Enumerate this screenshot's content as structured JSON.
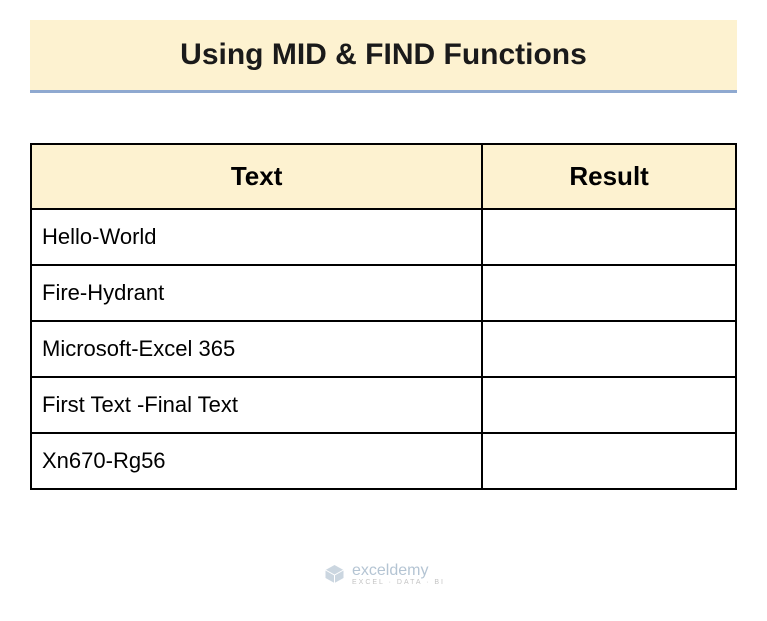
{
  "title": "Using MID & FIND Functions",
  "table": {
    "headers": {
      "text": "Text",
      "result": "Result"
    },
    "rows": [
      {
        "text": "Hello-World",
        "result": ""
      },
      {
        "text": "Fire-Hydrant",
        "result": ""
      },
      {
        "text": "Microsoft-Excel 365",
        "result": ""
      },
      {
        "text": "First Text -Final Text",
        "result": ""
      },
      {
        "text": "Xn670-Rg56",
        "result": ""
      }
    ]
  },
  "watermark": {
    "brand": "exceldemy",
    "tagline": "EXCEL · DATA · BI"
  },
  "chart_data": {
    "type": "table",
    "title": "Using MID & FIND Functions",
    "columns": [
      "Text",
      "Result"
    ],
    "rows": [
      [
        "Hello-World",
        ""
      ],
      [
        "Fire-Hydrant",
        ""
      ],
      [
        "Microsoft-Excel 365",
        ""
      ],
      [
        "First Text -Final Text",
        ""
      ],
      [
        "Xn670-Rg56",
        ""
      ]
    ]
  }
}
